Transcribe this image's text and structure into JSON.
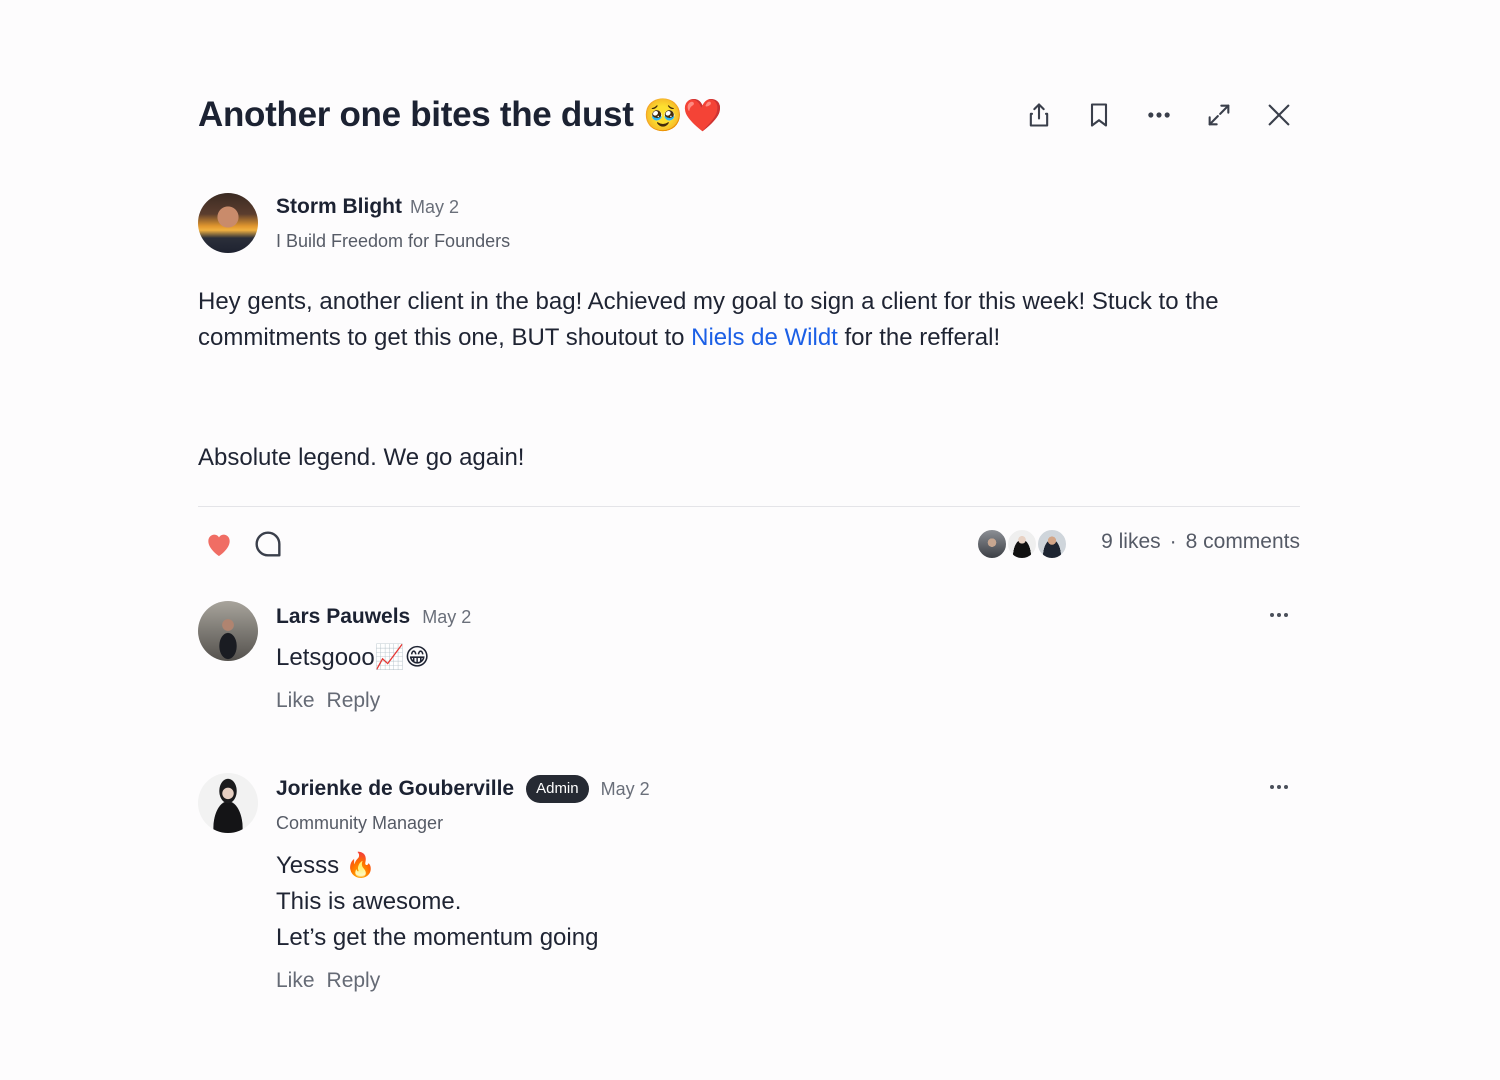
{
  "post": {
    "title": "Another one bites the dust",
    "title_emojis": "🥹❤️",
    "actions": {
      "share_icon": "share-icon",
      "bookmark_icon": "bookmark-icon",
      "more_icon": "more-horizontal-icon",
      "expand_icon": "expand-icon",
      "close_icon": "close-icon"
    },
    "author": {
      "name": "Storm Blight",
      "date": "May 2",
      "tagline": "I Build Freedom for Founders"
    },
    "body": {
      "part1": "Hey gents, another client in the bag! Achieved my goal to sign a client for this week! Stuck to the commitments to get this one, BUT shoutout to ",
      "mention": "Niels de Wildt",
      "part2": " for the refferal!",
      "paragraph2": "Absolute legend. We go again!"
    },
    "engagement": {
      "liked": true,
      "like_color": "#f06d64",
      "likes": "9 likes",
      "separator": "·",
      "comments": "8 comments"
    }
  },
  "comments": [
    {
      "name": "Lars Pauwels",
      "date": "May 2",
      "text": "Letsgooo📈😁",
      "like_label": "Like",
      "reply_label": "Reply"
    },
    {
      "name": "Jorienke de Gouberville",
      "badge": "Admin",
      "date": "May 2",
      "role": "Community Manager",
      "lines": [
        "Yesss 🔥",
        "This is awesome.",
        "Let’s get the momentum going"
      ],
      "like_label": "Like",
      "reply_label": "Reply"
    }
  ],
  "colors": {
    "accent_link": "#1b5fe6",
    "badge_bg": "#262a33",
    "text_primary": "#1c2232"
  }
}
